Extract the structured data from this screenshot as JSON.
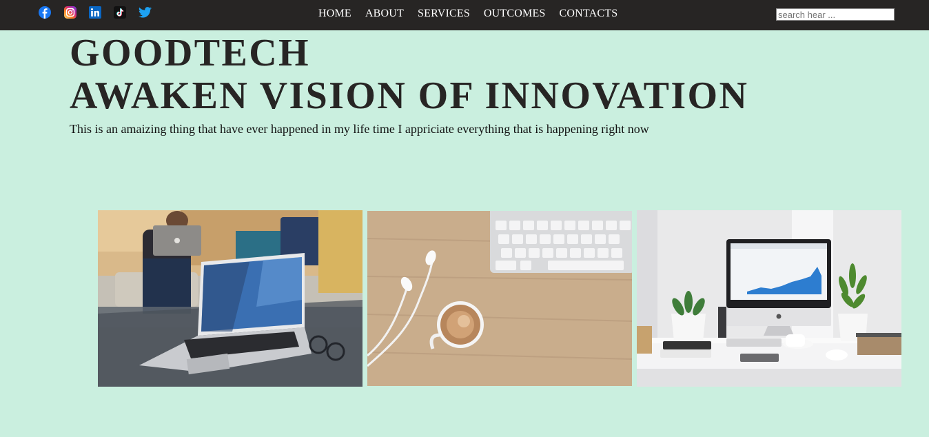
{
  "header": {
    "social": [
      {
        "name": "facebook-icon",
        "color": "#1877f2"
      },
      {
        "name": "instagram-icon",
        "color": "#d62976"
      },
      {
        "name": "linkedin-icon",
        "color": "#0a66c2"
      },
      {
        "name": "tiktok-icon",
        "color": "#000000"
      },
      {
        "name": "twitter-icon",
        "color": "#1da1f2"
      }
    ],
    "nav": [
      "HOME",
      "ABOUT",
      "SERVICES",
      "OUTCOMES",
      "CONTACTS"
    ],
    "search": {
      "placeholder": "search hear ...",
      "value": ""
    }
  },
  "hero": {
    "title_line1": "GOODTECH",
    "title_line2": "AWAKEN VISION OF INNOVATION",
    "tagline": "This is an amaizing thing that have ever happened in my life time I appriciate everything that is happening right now"
  },
  "gallery": {
    "images": [
      {
        "name": "photo-laptop-coffee-table"
      },
      {
        "name": "photo-keyboard-earphones-coffee"
      },
      {
        "name": "photo-imac-desk"
      }
    ]
  },
  "colors": {
    "background": "#caefdf",
    "navbar": "#272524",
    "nav_text": "#ffffff",
    "heading": "#272524"
  }
}
